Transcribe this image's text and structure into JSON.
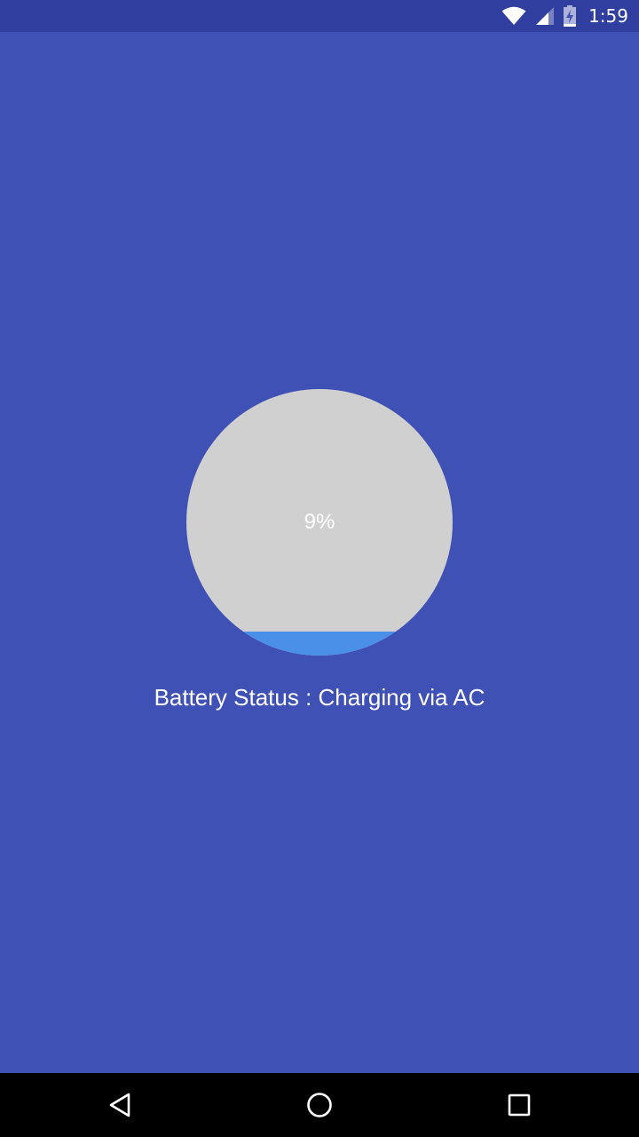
{
  "status_bar": {
    "time": "1:59",
    "icons": [
      "wifi-icon",
      "cell-signal-icon",
      "battery-charging-icon"
    ]
  },
  "battery": {
    "level_label": "9%",
    "level_fraction": 0.09,
    "status_text": "Battery Status : Charging via AC"
  },
  "colors": {
    "background": "#3f51b5",
    "status_bar": "#303f9f",
    "gauge_empty": "#d0d0d0",
    "gauge_fill": "#4a90e8",
    "text": "#ffffff"
  },
  "nav_bar": {
    "buttons": [
      "back-icon",
      "home-icon",
      "recents-icon"
    ]
  }
}
